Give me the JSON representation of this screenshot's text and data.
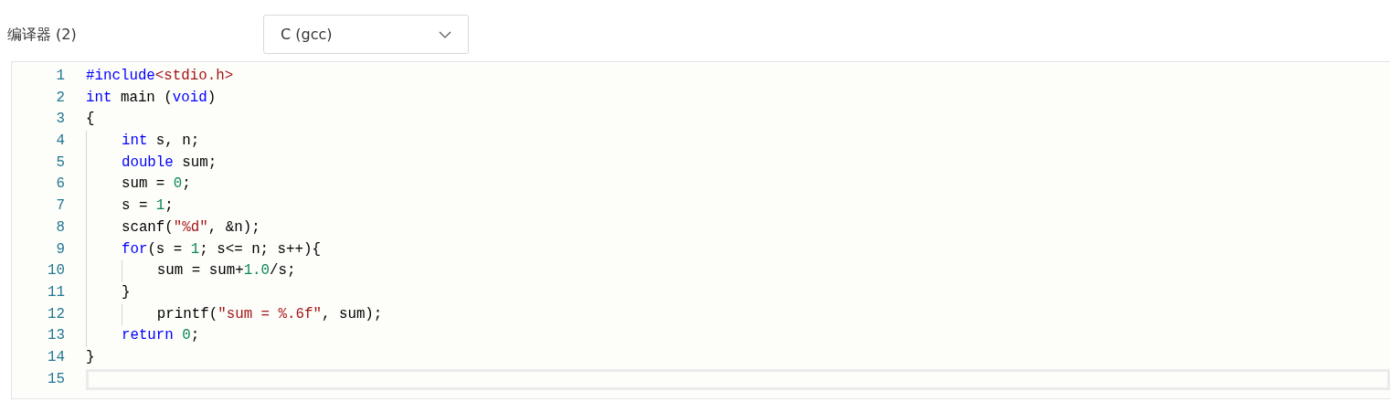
{
  "compiler": {
    "label": "编译器 (2)",
    "value": "C (gcc)"
  },
  "editor": {
    "lines": [
      {
        "number": "1",
        "current": false,
        "tokens": [
          {
            "kind": "directive",
            "text": "#include"
          },
          {
            "kind": "string",
            "text": "<stdio.h>"
          }
        ]
      },
      {
        "number": "2",
        "current": false,
        "tokens": [
          {
            "kind": "keyword",
            "text": "int"
          },
          {
            "kind": "plain",
            "text": " main ("
          },
          {
            "kind": "keyword",
            "text": "void"
          },
          {
            "kind": "plain",
            "text": ")"
          }
        ]
      },
      {
        "number": "3",
        "current": false,
        "tokens": [
          {
            "kind": "plain",
            "text": "{"
          }
        ]
      },
      {
        "number": "4",
        "current": false,
        "tokens": [
          {
            "kind": "keyword",
            "text": "    int"
          },
          {
            "kind": "plain",
            "text": " s, n;"
          }
        ]
      },
      {
        "number": "5",
        "current": false,
        "tokens": [
          {
            "kind": "keyword",
            "text": "    double"
          },
          {
            "kind": "plain",
            "text": " sum;"
          }
        ]
      },
      {
        "number": "6",
        "current": false,
        "tokens": [
          {
            "kind": "plain",
            "text": "    sum = "
          },
          {
            "kind": "number",
            "text": "0"
          },
          {
            "kind": "plain",
            "text": ";"
          }
        ]
      },
      {
        "number": "7",
        "current": false,
        "tokens": [
          {
            "kind": "plain",
            "text": "    s = "
          },
          {
            "kind": "number",
            "text": "1"
          },
          {
            "kind": "plain",
            "text": ";"
          }
        ]
      },
      {
        "number": "8",
        "current": false,
        "tokens": [
          {
            "kind": "plain",
            "text": "    scanf("
          },
          {
            "kind": "string",
            "text": "\"%d\""
          },
          {
            "kind": "plain",
            "text": ", &n);"
          }
        ]
      },
      {
        "number": "9",
        "current": false,
        "tokens": [
          {
            "kind": "keyword",
            "text": "    for"
          },
          {
            "kind": "plain",
            "text": "(s = "
          },
          {
            "kind": "number",
            "text": "1"
          },
          {
            "kind": "plain",
            "text": "; s<= n; s++){"
          }
        ]
      },
      {
        "number": "10",
        "current": false,
        "tokens": [
          {
            "kind": "plain",
            "text": "        sum = sum+"
          },
          {
            "kind": "number",
            "text": "1.0"
          },
          {
            "kind": "plain",
            "text": "/s;"
          }
        ]
      },
      {
        "number": "11",
        "current": false,
        "tokens": [
          {
            "kind": "plain",
            "text": "    }"
          }
        ]
      },
      {
        "number": "12",
        "current": false,
        "tokens": [
          {
            "kind": "plain",
            "text": "        printf("
          },
          {
            "kind": "string",
            "text": "\"sum = %.6f\""
          },
          {
            "kind": "plain",
            "text": ", sum);"
          }
        ]
      },
      {
        "number": "13",
        "current": false,
        "tokens": [
          {
            "kind": "keyword",
            "text": "    return "
          },
          {
            "kind": "number",
            "text": "0"
          },
          {
            "kind": "plain",
            "text": ";"
          }
        ]
      },
      {
        "number": "14",
        "current": false,
        "tokens": [
          {
            "kind": "plain",
            "text": "}"
          }
        ]
      },
      {
        "number": "15",
        "current": true
      }
    ]
  }
}
